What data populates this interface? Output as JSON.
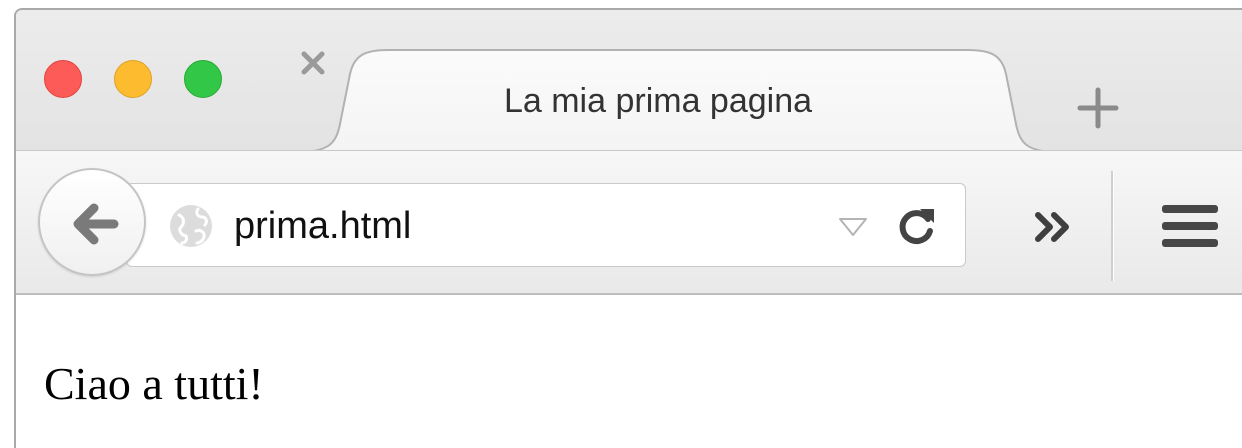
{
  "window": {
    "traffic_lights": {
      "close_color": "#fc5b57",
      "minimize_color": "#fdbc2f",
      "maximize_color": "#33c748"
    }
  },
  "tab": {
    "title": "La mia prima pagina",
    "close_icon": "close-x-icon",
    "new_tab_icon": "plus-icon"
  },
  "toolbar": {
    "back_icon": "back-arrow-icon",
    "site_icon": "globe-icon",
    "url": "prima.html",
    "dropdown_icon": "triangle-down-icon",
    "reload_icon": "reload-icon",
    "overflow_icon": "double-chevron-right-icon",
    "menu_icon": "hamburger-menu-icon"
  },
  "page": {
    "text": "Ciao a tutti!"
  }
}
